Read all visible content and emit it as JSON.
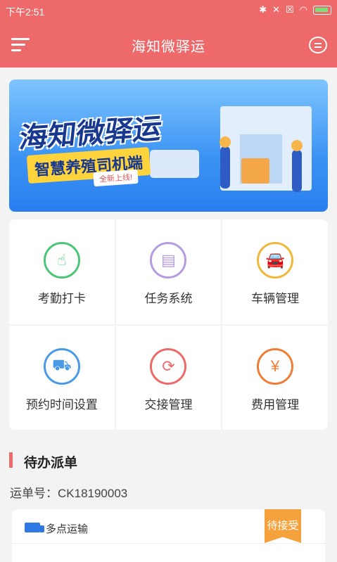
{
  "status_bar": {
    "time": "下午2:51",
    "icons": [
      "bluetooth-icon",
      "mute-icon",
      "no-sim-icon",
      "wifi-icon",
      "battery-icon"
    ]
  },
  "nav": {
    "title": "海知微驿运",
    "left_icon": "menu-icon",
    "right_icon": "message-icon"
  },
  "banner": {
    "title": "海知微驿运",
    "subtitle": "智慧养殖司机端",
    "tag": "全新上线!"
  },
  "functions": [
    {
      "label": "考勤打卡",
      "icon": "hand-tap-icon",
      "color": "#4cc576",
      "glyph": "☝"
    },
    {
      "label": "任务系统",
      "icon": "document-icon",
      "color": "#b59be0",
      "glyph": "▤"
    },
    {
      "label": "车辆管理",
      "icon": "car-icon",
      "color": "#f0b83a",
      "glyph": "🚘"
    },
    {
      "label": "预约时间设置",
      "icon": "schedule-truck-icon",
      "color": "#4a9ae8",
      "glyph": "⛟"
    },
    {
      "label": "交接管理",
      "icon": "handover-truck-icon",
      "color": "#ee6a6a",
      "glyph": "⟳"
    },
    {
      "label": "费用管理",
      "icon": "fee-icon",
      "color": "#ef7d36",
      "glyph": "¥"
    }
  ],
  "pending": {
    "section_title": "待办派单",
    "waybill_label": "运单号：CK18190003"
  },
  "order_card": {
    "type_label": "多点运输",
    "status_badge": "待接受"
  },
  "colors": {
    "accent": "#ee6a6a",
    "badge": "#f6a23c"
  }
}
